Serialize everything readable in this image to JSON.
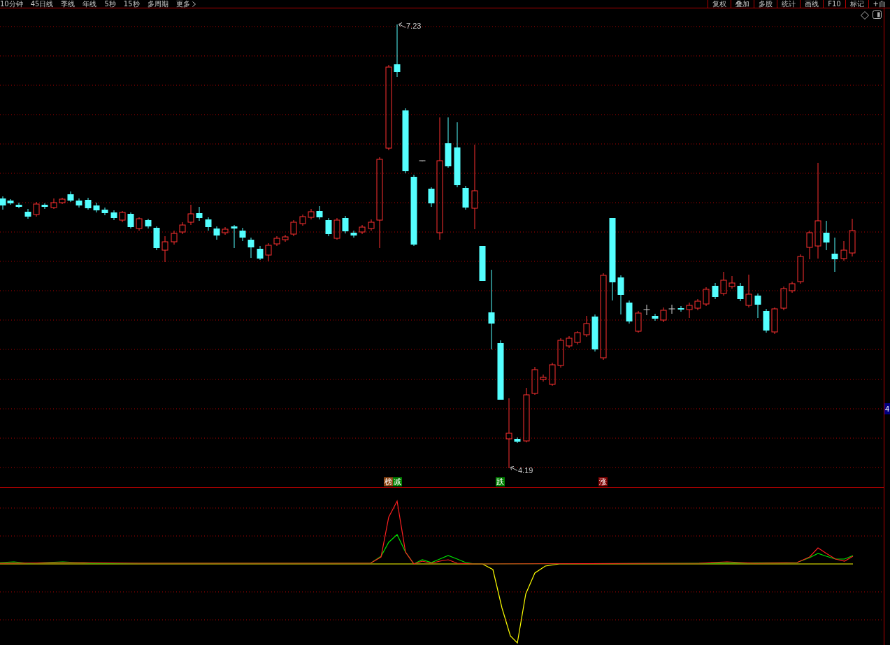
{
  "toolbar": {
    "periods": [
      "10分钟",
      "45日线",
      "季线",
      "年线",
      "5秒",
      "15秒",
      "多周期",
      "更多"
    ],
    "tools": [
      "复权",
      "叠加",
      "多股",
      "统计",
      "画线",
      "F10",
      "标记",
      "+自"
    ]
  },
  "price_chart": {
    "high_label": "7.23",
    "low_label": "4.19",
    "axis_badge": "4"
  },
  "signal_tags": [
    {
      "text": "榜",
      "color": "#8b4513"
    },
    {
      "text": "减",
      "color": "#008000"
    },
    {
      "text": "跌",
      "color": "#008000"
    },
    {
      "text": "涨",
      "color": "#800000"
    }
  ]
}
